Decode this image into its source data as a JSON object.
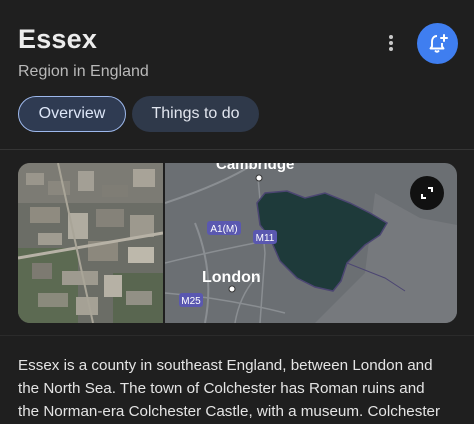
{
  "header": {
    "title": "Essex",
    "subtitle": "Region in England"
  },
  "icons": {
    "more": "more-vert-icon",
    "follow": "add-alert-bell-icon",
    "expand": "expand-icon"
  },
  "colors": {
    "accent": "#3f7ef0",
    "background": "#1f1f1f",
    "map_region": "#1e3a3a"
  },
  "tabs": [
    {
      "label": "Overview",
      "selected": true
    },
    {
      "label": "Things to do",
      "selected": false
    }
  ],
  "map": {
    "labels": {
      "cambridge": "Cambridge",
      "london": "London",
      "a1m": "A1(M)",
      "m11": "M11",
      "m25": "M25"
    }
  },
  "description": {
    "lines": [
      "Essex is a county in southeast England, between London and",
      "the North Sea. The town of Colchester has Roman ruins and",
      "the Norman-era Colchester Castle, with a museum. Colchester"
    ]
  }
}
